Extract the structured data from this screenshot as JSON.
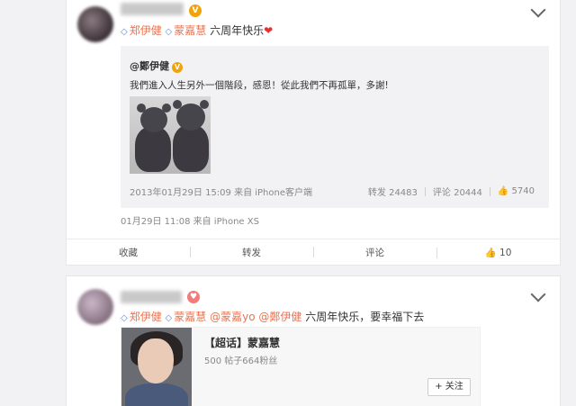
{
  "post1": {
    "text_suffix": "六周年快乐",
    "mentions": [
      "郑伊健",
      "蒙嘉慧"
    ],
    "repost": {
      "author": "@鄭伊健",
      "text": "我們進入人生另外一個階段，感恩！從此我們不再孤單，多謝!",
      "meta": "2013年01月29日 15:09 来自 iPhone客户端",
      "repost_count": "转发 24483",
      "comment_count": "评论 20444",
      "like_count": "5740"
    },
    "meta": "01月29日 11:08 来自 iPhone XS",
    "actions": {
      "favorite": "收藏",
      "repost": "转发",
      "comment": "评论",
      "like": "10"
    }
  },
  "post2": {
    "mentions": [
      "郑伊健",
      "蒙嘉慧",
      "@蒙嘉yo",
      "@鄭伊健"
    ],
    "text_suffix": "六周年快乐，要幸福下去",
    "topic": {
      "title": "【超话】蒙嘉慧",
      "stats": "500 帖子664粉丝",
      "follow_label": "+ 关注"
    }
  }
}
